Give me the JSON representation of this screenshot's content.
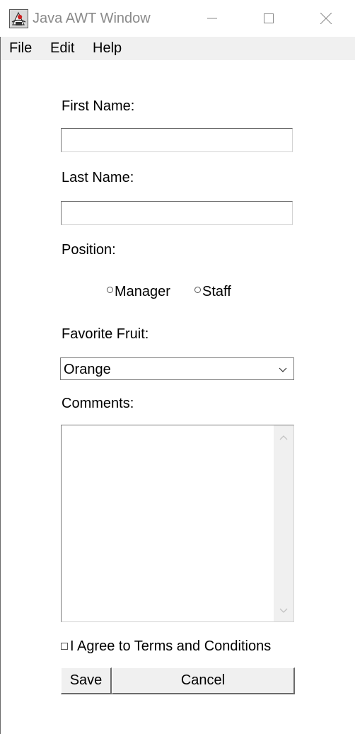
{
  "window": {
    "title": "Java AWT Window"
  },
  "menubar": {
    "items": [
      "File",
      "Edit",
      "Help"
    ]
  },
  "form": {
    "first_name_label": "First Name:",
    "first_name_value": "",
    "last_name_label": "Last Name:",
    "last_name_value": "",
    "position_label": "Position:",
    "position_options": [
      "Manager",
      "Staff"
    ],
    "fruit_label": "Favorite Fruit:",
    "fruit_selected": "Orange",
    "comments_label": "Comments:",
    "comments_value": "",
    "agree_label": "I Agree to Terms and Conditions",
    "agree_checked": false
  },
  "buttons": {
    "save": "Save",
    "cancel": "Cancel"
  }
}
